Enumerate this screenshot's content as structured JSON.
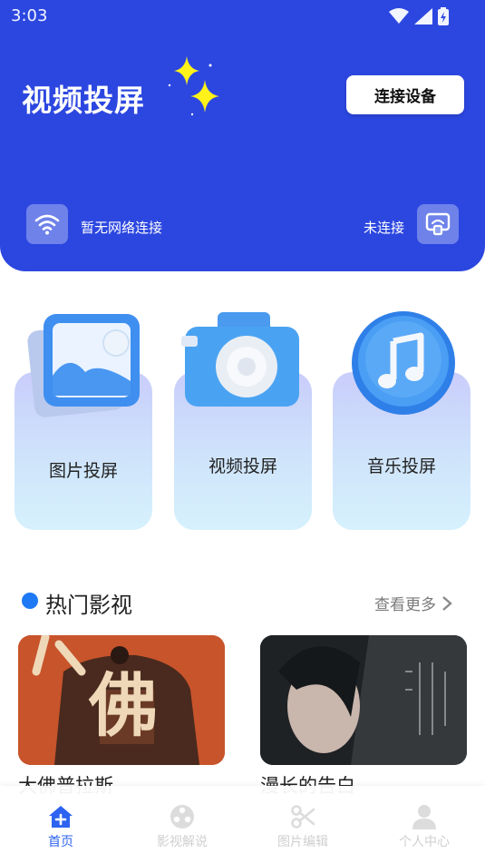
{
  "status_bar": {
    "time": "3:03"
  },
  "header": {
    "title": "视频投屏",
    "connect_button": "连接设备",
    "network_status": "暂无网络连接",
    "connection_status": "未连接"
  },
  "features": [
    {
      "label": "图片投屏",
      "icon": "photo-icon"
    },
    {
      "label": "视频投屏",
      "icon": "camera-icon"
    },
    {
      "label": "音乐投屏",
      "icon": "music-icon"
    }
  ],
  "hot_section": {
    "title": "热门影视",
    "more_label": "查看更多",
    "movies": [
      {
        "title": "大佛普拉斯",
        "poster_text": "佛"
      },
      {
        "title": "漫长的告白"
      }
    ]
  },
  "bottom_nav": [
    {
      "label": "首页",
      "icon": "home-icon",
      "active": true
    },
    {
      "label": "影视解说",
      "icon": "film-reel-icon",
      "active": false
    },
    {
      "label": "图片编辑",
      "icon": "scissors-icon",
      "active": false
    },
    {
      "label": "个人中心",
      "icon": "user-icon",
      "active": false
    }
  ],
  "colors": {
    "header_bg": "#2c47e0",
    "accent": "#1e79f5",
    "nav_active": "#2d63f0",
    "nav_inactive": "#cfcfcf"
  }
}
